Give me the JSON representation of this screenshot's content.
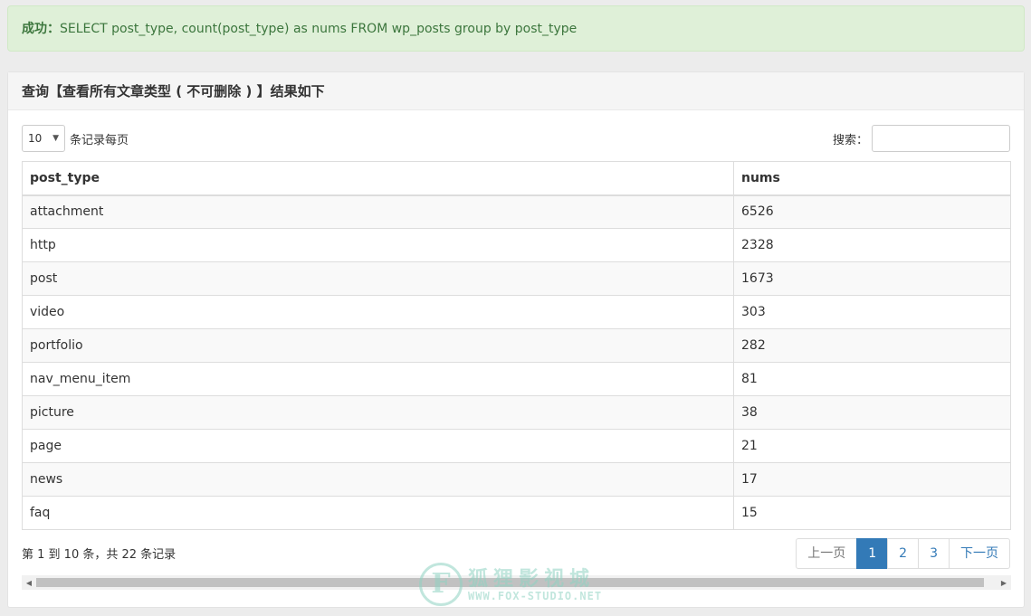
{
  "alert": {
    "label": "成功：",
    "message": "SELECT post_type, count(post_type) as nums FROM wp_posts group by post_type"
  },
  "panel": {
    "title": "查询【查看所有文章类型 ( 不可删除 ) 】结果如下"
  },
  "length": {
    "value": "10",
    "label": "条记录每页"
  },
  "search": {
    "label": "搜索：",
    "value": ""
  },
  "table": {
    "headers": [
      "post_type",
      "nums"
    ],
    "rows": [
      [
        "attachment",
        "6526"
      ],
      [
        "http",
        "2328"
      ],
      [
        "post",
        "1673"
      ],
      [
        "video",
        "303"
      ],
      [
        "portfolio",
        "282"
      ],
      [
        "nav_menu_item",
        "81"
      ],
      [
        "picture",
        "38"
      ],
      [
        "page",
        "21"
      ],
      [
        "news",
        "17"
      ],
      [
        "faq",
        "15"
      ]
    ]
  },
  "info": "第 1 到 10 条，共 22 条记录",
  "pager": {
    "prev": "上一页",
    "pages": [
      "1",
      "2",
      "3"
    ],
    "active": "1",
    "next": "下一页"
  },
  "watermark": {
    "logo_letter": "F",
    "cn": "狐狸影视城",
    "en": "WWW.FOX-STUDIO.NET"
  },
  "colors": {
    "alert_bg": "#dff0d8",
    "alert_text": "#3c763d",
    "accent": "#337ab7"
  }
}
